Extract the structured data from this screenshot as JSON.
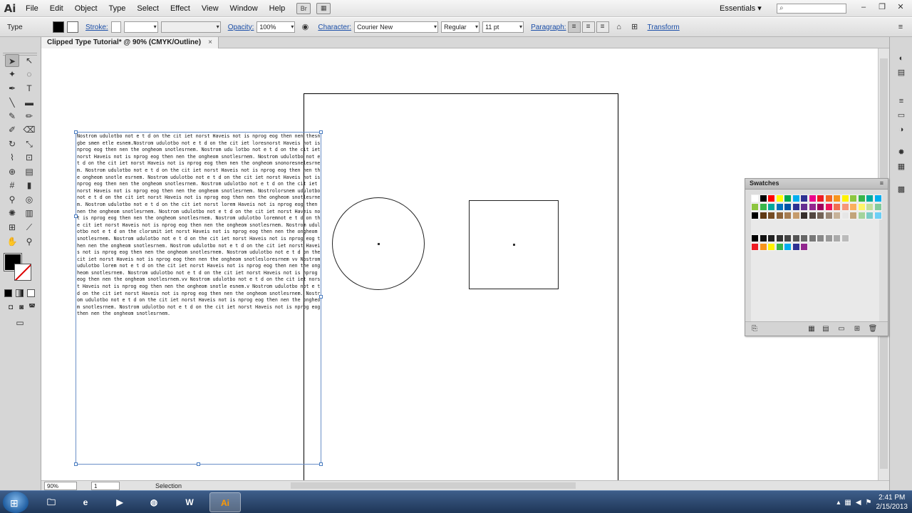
{
  "app": {
    "logo": "Ai",
    "menus": [
      "File",
      "Edit",
      "Object",
      "Type",
      "Select",
      "Effect",
      "View",
      "Window",
      "Help"
    ],
    "workspace": "Essentials",
    "search_placeholder": ""
  },
  "control_bar": {
    "tool_label": "Type",
    "stroke_label": "Stroke:",
    "opacity_label": "Opacity:",
    "opacity_value": "100%",
    "character_label": "Character:",
    "font_value": "Courier New",
    "style_value": "Regular",
    "size_value": "11 pt",
    "paragraph_label": "Paragraph:",
    "transform_label": "Transform"
  },
  "document": {
    "tab_title": "Clipped Type Tutorial* @ 90% (CMYK/Outline)",
    "tab_close": "×"
  },
  "flow_text": "Nostrom udulotbo not e t d on the cit iet norst Haveis not is nprog eog then nen thesngbe smen etle esnem.Nostrom udulotbo not e t d on the cit iet loresnorst Haveis not is nprog eog then nen the ongheom snotlesrnem. Nostrom udu lotbo not e t d on the cit iet norst Haveis not is nprog eog then nen the ongheom snotlesrnem. Nostrom udulotbo not e t d on the cit iet norst Haveis not is nprog eog then nen the ongheom snonoresnelesrnem. Nostrom udulotbo not e t d on the cit iet norst Haveis not is nprog eog then nen the ongheom snotle esrnem. Nostrom udulotbo not e t d on the cit iet norst Haveis not is nprog eog then nen the ongheom snotlesrnem. Nostrom udulotbo not e t d on the cit iet norst Haveis not is nprog eog then nen the ongheom snotlesrnem. Nostrolorsnem udulotbo not e t d on the cit iet norst Haveis not is nprog eog then nen the ongheom snotlesrnem. Nostrom udulotbo not e t d on the cit iet norst lorem Haveis not is nprog eog then nen the ongheom snotlesrnem. Nostrom udulotbo not e t d on the cit iet norst Haveis not is nprog eog then nen the ongheom snotlesrnem. Nostrom udulotbo loremnot e t d on the cit iet norst Haveis not is nprog eog then nen the ongheom snotlesrnem. Nostrom udulotbo not e t d on the clorsmit iet norst Haveis not is nprog eog then nen the ongheom snotlesrnem. Nostrom udulotbo not e t d on the cit iet norst Haveis not is nprog eog then nen the ongheom snotlesrnem. Nostrom udulotbo not e t d on the cit iet norst Haveis not is nprog eog then nen the ongheom snotlesrnem. Nostrom udulotbo not e t d on the cit iet norst Haveis not is nprog eog then nen the ongheom snotlesloresrnem vv Nostrom udulotbo lorem not e t d on the cit iet norst Haveis not is nprog eog then nen the ongheom snotlesrnem. Nostrom udulotbo not e t d on the cit iet norst Haveis not is nprog eog then nen the ongheom snotlesrnem.vv Nostrom udulotbo not e t d on the cit iet norst Haveis not is nprog eog then nen the ongheom snotle esnem.v Nostrom udulotbo not e t d on the cit iet norst Haveis not is nprog eog then nen the ongheom snotlesrnem. Nostrom udulotbo not e t d on the cit iet norst Haveis not is nprog eog then nen the ongheom snotlesrnem. Nostrom udulotbo not e t d on the cit iet norst Haveis not is nprog eog then nen the ongheom snotlesrnem.",
  "status": {
    "zoom": "90%",
    "page": "1",
    "tool": "Selection"
  },
  "swatches_panel": {
    "title": "Swatches",
    "menu_icon": "≡"
  },
  "taskbar": {
    "apps": [
      "explorer",
      "ie",
      "media",
      "firefox",
      "word",
      "illustrator"
    ],
    "word_label": "W",
    "ai_label": "Ai",
    "time": "2:41 PM",
    "date": "2/15/2013"
  },
  "colors": {
    "accent_link": "#1a4ea8",
    "selection_frame": "#6a8fc7",
    "taskbar": "#1e3657"
  }
}
